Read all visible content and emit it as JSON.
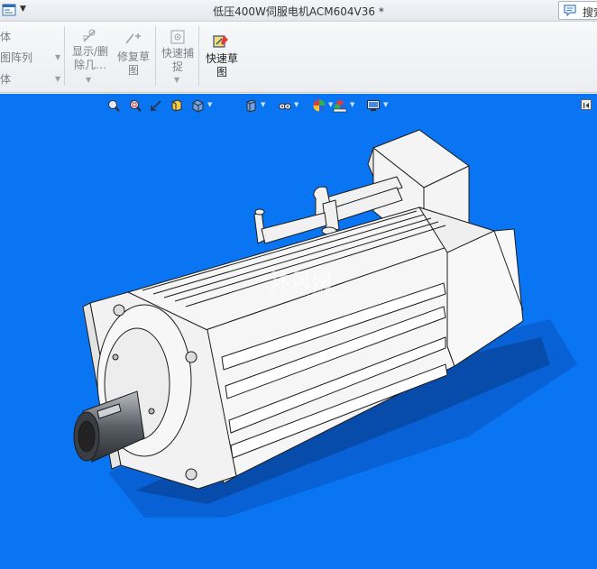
{
  "titlebar": {
    "document_title": "低压400W伺服电机ACM604V36 *",
    "search_label": "搜索"
  },
  "ribbon": {
    "left_items": [
      "体",
      "图阵列",
      "体"
    ],
    "buttons": {
      "display_delete": "显示/删\n除几…",
      "display_delete_line1": "显示/删",
      "display_delete_line2": "除几…",
      "repair_sketch_line1": "修复草",
      "repair_sketch_line2": "图",
      "quick_snap_line1": "快速捕",
      "quick_snap_line2": "捉",
      "quick_sketch_line1": "快速草",
      "quick_sketch_line2": "图"
    }
  },
  "viewport": {
    "background_color": "#0a75f2",
    "heads_up_icons": [
      "zoom-to-fit-icon",
      "zoom-to-area-icon",
      "previous-view-icon",
      "section-view-icon",
      "view-orientation-icon",
      "display-style-icon",
      "hide-show-items-icon",
      "edit-appearance-icon",
      "apply-scene-icon",
      "view-settings-icon"
    ],
    "watermark": {
      "main": "沐风网",
      "sub": "www.mfcad.com"
    },
    "model_name": "servo-motor"
  }
}
